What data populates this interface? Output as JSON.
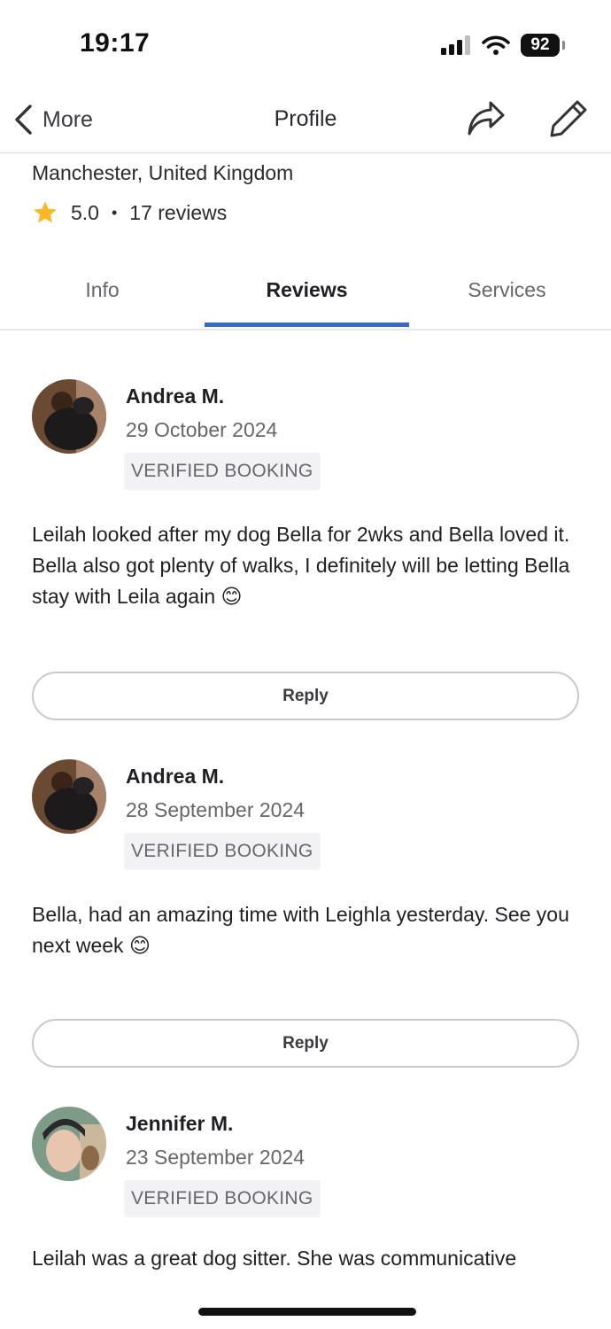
{
  "status_bar": {
    "time": "19:17",
    "battery": "92"
  },
  "nav": {
    "back_label": "More",
    "title": "Profile"
  },
  "profile": {
    "location": "Manchester, United Kingdom",
    "rating": "5.0",
    "separator": "•",
    "reviews_count": "17 reviews"
  },
  "tabs": [
    {
      "label": "Info"
    },
    {
      "label": "Reviews",
      "active": true
    },
    {
      "label": "Services"
    }
  ],
  "reviews": [
    {
      "name": "Andrea M.",
      "date": "29 October 2024",
      "badge": "VERIFIED BOOKING",
      "text": "Leilah looked after my dog Bella for 2wks and Bella loved it. Bella also got plenty of walks, I definitely will be letting Bella stay with Leila again 😊",
      "reply_label": "Reply"
    },
    {
      "name": "Andrea M.",
      "date": "28 September 2024",
      "badge": "VERIFIED BOOKING",
      "text": "Bella, had an amazing time with Leighla yesterday. See you next week  😊",
      "reply_label": "Reply"
    },
    {
      "name": "Jennifer M.",
      "date": "23 September 2024",
      "badge": "VERIFIED BOOKING",
      "text": "Leilah was a great dog sitter. She was communicative"
    }
  ],
  "colors": {
    "accent": "#3469c6",
    "star": "#f7b928",
    "muted_text": "#66676d"
  }
}
